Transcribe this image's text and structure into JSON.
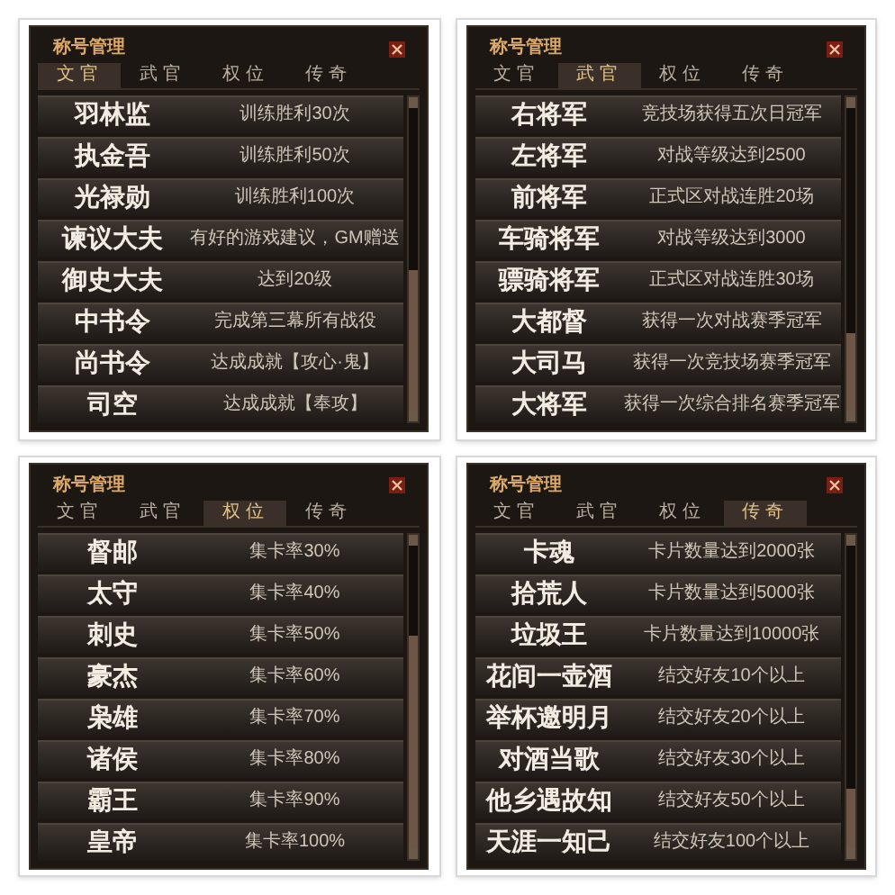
{
  "panels": [
    {
      "title": "称号管理",
      "tabs": [
        {
          "label": "文官",
          "selected": true
        },
        {
          "label": "武官",
          "selected": false
        },
        {
          "label": "权位",
          "selected": false
        },
        {
          "label": "传奇",
          "selected": false
        }
      ],
      "rows": [
        {
          "name": "羽林监",
          "requirement": "训练胜利30次"
        },
        {
          "name": "执金吾",
          "requirement": "训练胜利50次"
        },
        {
          "name": "光禄勋",
          "requirement": "训练胜利100次"
        },
        {
          "name": "谏议大夫",
          "requirement": "有好的游戏建议，GM赠送"
        },
        {
          "name": "御史大夫",
          "requirement": "达到20级"
        },
        {
          "name": "中书令",
          "requirement": "完成第三幕所有战役"
        },
        {
          "name": "尚书令",
          "requirement": "达成成就【攻心·鬼】"
        },
        {
          "name": "司空",
          "requirement": "达成成就【奉攻】"
        }
      ]
    },
    {
      "title": "称号管理",
      "tabs": [
        {
          "label": "文官",
          "selected": false
        },
        {
          "label": "武官",
          "selected": true
        },
        {
          "label": "权位",
          "selected": false
        },
        {
          "label": "传奇",
          "selected": false
        }
      ],
      "rows": [
        {
          "name": "右将军",
          "requirement": "竞技场获得五次日冠军"
        },
        {
          "name": "左将军",
          "requirement": "对战等级达到2500"
        },
        {
          "name": "前将军",
          "requirement": "正式区对战连胜20场"
        },
        {
          "name": "车骑将军",
          "requirement": "对战等级达到3000"
        },
        {
          "name": "骠骑将军",
          "requirement": "正式区对战连胜30场"
        },
        {
          "name": "大都督",
          "requirement": "获得一次对战赛季冠军"
        },
        {
          "name": "大司马",
          "requirement": "获得一次竞技场赛季冠军"
        },
        {
          "name": "大将军",
          "requirement": "获得一次综合排名赛季冠军"
        }
      ]
    },
    {
      "title": "称号管理",
      "tabs": [
        {
          "label": "文官",
          "selected": false
        },
        {
          "label": "武官",
          "selected": false
        },
        {
          "label": "权位",
          "selected": true
        },
        {
          "label": "传奇",
          "selected": false
        }
      ],
      "rows": [
        {
          "name": "督邮",
          "requirement": "集卡率30%"
        },
        {
          "name": "太守",
          "requirement": "集卡率40%"
        },
        {
          "name": "刺史",
          "requirement": "集卡率50%"
        },
        {
          "name": "豪杰",
          "requirement": "集卡率60%"
        },
        {
          "name": "枭雄",
          "requirement": "集卡率70%"
        },
        {
          "name": "诸侯",
          "requirement": "集卡率80%"
        },
        {
          "name": "霸王",
          "requirement": "集卡率90%"
        },
        {
          "name": "皇帝",
          "requirement": "集卡率100%"
        }
      ]
    },
    {
      "title": "称号管理",
      "tabs": [
        {
          "label": "文官",
          "selected": false
        },
        {
          "label": "武官",
          "selected": false
        },
        {
          "label": "权位",
          "selected": false
        },
        {
          "label": "传奇",
          "selected": true
        }
      ],
      "rows": [
        {
          "name": "卡魂",
          "requirement": "卡片数量达到2000张"
        },
        {
          "name": "拾荒人",
          "requirement": "卡片数量达到5000张"
        },
        {
          "name": "垃圾王",
          "requirement": "卡片数量达到10000张"
        },
        {
          "name": "花间一壶酒",
          "requirement": "结交好友10个以上"
        },
        {
          "name": "举杯邀明月",
          "requirement": "结交好友20个以上"
        },
        {
          "name": "对酒当歌",
          "requirement": "结交好友30个以上"
        },
        {
          "name": "他乡遇故知",
          "requirement": "结交好友50个以上"
        },
        {
          "name": "天涯一知己",
          "requirement": "结交好友100个以上"
        }
      ]
    }
  ]
}
